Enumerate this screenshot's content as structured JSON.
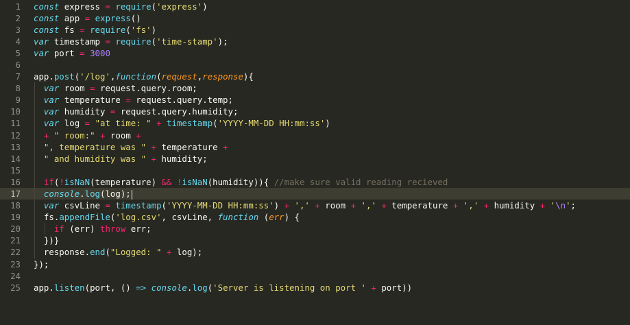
{
  "editor": {
    "colors": {
      "background": "#272822",
      "active_line": "#3e3d32",
      "keyword": "#66d9ef",
      "operator": "#f92672",
      "string": "#e6db74",
      "number": "#ae81ff",
      "parameter": "#fd971f",
      "comment": "#75715e",
      "text": "#f8f8f2",
      "gutter": "#90908a"
    },
    "active_line_number": "17",
    "lines": [
      {
        "n": "1",
        "tokens": [
          [
            "kw",
            "const"
          ],
          [
            "pl",
            " express "
          ],
          [
            "op",
            "="
          ],
          [
            "pl",
            " "
          ],
          [
            "fn",
            "require"
          ],
          [
            "pl",
            "("
          ],
          [
            "str",
            "'express'"
          ],
          [
            "pl",
            ")"
          ]
        ]
      },
      {
        "n": "2",
        "tokens": [
          [
            "kw",
            "const"
          ],
          [
            "pl",
            " app "
          ],
          [
            "op",
            "="
          ],
          [
            "pl",
            " "
          ],
          [
            "fn",
            "express"
          ],
          [
            "pl",
            "()"
          ]
        ]
      },
      {
        "n": "3",
        "tokens": [
          [
            "kw",
            "const"
          ],
          [
            "pl",
            " fs "
          ],
          [
            "op",
            "="
          ],
          [
            "pl",
            " "
          ],
          [
            "fn",
            "require"
          ],
          [
            "pl",
            "("
          ],
          [
            "str",
            "'fs'"
          ],
          [
            "pl",
            ")"
          ]
        ]
      },
      {
        "n": "4",
        "tokens": [
          [
            "kw",
            "var"
          ],
          [
            "pl",
            " timestamp "
          ],
          [
            "op",
            "="
          ],
          [
            "pl",
            " "
          ],
          [
            "fn",
            "require"
          ],
          [
            "pl",
            "("
          ],
          [
            "str",
            "'time-stamp'"
          ],
          [
            "pl",
            ");"
          ]
        ]
      },
      {
        "n": "5",
        "tokens": [
          [
            "kw",
            "var"
          ],
          [
            "pl",
            " port "
          ],
          [
            "op",
            "="
          ],
          [
            "pl",
            " "
          ],
          [
            "num",
            "3000"
          ]
        ]
      },
      {
        "n": "6",
        "tokens": []
      },
      {
        "n": "7",
        "tokens": [
          [
            "pl",
            "app."
          ],
          [
            "fn",
            "post"
          ],
          [
            "pl",
            "("
          ],
          [
            "str",
            "'/log'"
          ],
          [
            "pl",
            ","
          ],
          [
            "kw",
            "function"
          ],
          [
            "pl",
            "("
          ],
          [
            "param",
            "request"
          ],
          [
            "pl",
            ","
          ],
          [
            "param",
            "response"
          ],
          [
            "pl",
            "){"
          ]
        ]
      },
      {
        "n": "8",
        "tokens": [
          [
            "pl",
            "  "
          ],
          [
            "kw",
            "var"
          ],
          [
            "pl",
            " room "
          ],
          [
            "op",
            "="
          ],
          [
            "pl",
            " request.query.room;"
          ]
        ]
      },
      {
        "n": "9",
        "tokens": [
          [
            "pl",
            "  "
          ],
          [
            "kw",
            "var"
          ],
          [
            "pl",
            " temperature "
          ],
          [
            "op",
            "="
          ],
          [
            "pl",
            " request.query.temp;"
          ]
        ]
      },
      {
        "n": "10",
        "tokens": [
          [
            "pl",
            "  "
          ],
          [
            "kw",
            "var"
          ],
          [
            "pl",
            " humidity "
          ],
          [
            "op",
            "="
          ],
          [
            "pl",
            " request.query.humidity;"
          ]
        ]
      },
      {
        "n": "11",
        "tokens": [
          [
            "pl",
            "  "
          ],
          [
            "kw",
            "var"
          ],
          [
            "pl",
            " log "
          ],
          [
            "op",
            "="
          ],
          [
            "pl",
            " "
          ],
          [
            "str",
            "\"at time: \""
          ],
          [
            "pl",
            " "
          ],
          [
            "op",
            "+"
          ],
          [
            "pl",
            " "
          ],
          [
            "fn",
            "timestamp"
          ],
          [
            "pl",
            "("
          ],
          [
            "str",
            "'YYYY-MM-DD HH:mm:ss'"
          ],
          [
            "pl",
            ")"
          ]
        ]
      },
      {
        "n": "12",
        "tokens": [
          [
            "pl",
            "  "
          ],
          [
            "op",
            "+"
          ],
          [
            "pl",
            " "
          ],
          [
            "str",
            "\" room:\""
          ],
          [
            "pl",
            " "
          ],
          [
            "op",
            "+"
          ],
          [
            "pl",
            " room "
          ],
          [
            "op",
            "+"
          ]
        ]
      },
      {
        "n": "13",
        "tokens": [
          [
            "pl",
            "  "
          ],
          [
            "str",
            "\", temperature was \""
          ],
          [
            "pl",
            " "
          ],
          [
            "op",
            "+"
          ],
          [
            "pl",
            " temperature "
          ],
          [
            "op",
            "+"
          ]
        ]
      },
      {
        "n": "14",
        "tokens": [
          [
            "pl",
            "  "
          ],
          [
            "str",
            "\" and humidity was \""
          ],
          [
            "pl",
            " "
          ],
          [
            "op",
            "+"
          ],
          [
            "pl",
            " humidity;"
          ]
        ]
      },
      {
        "n": "15",
        "tokens": []
      },
      {
        "n": "16",
        "tokens": [
          [
            "pl",
            "  "
          ],
          [
            "op",
            "if"
          ],
          [
            "pl",
            "("
          ],
          [
            "op",
            "!"
          ],
          [
            "fn",
            "isNaN"
          ],
          [
            "pl",
            "(temperature) "
          ],
          [
            "op",
            "&&"
          ],
          [
            "pl",
            " "
          ],
          [
            "op",
            "!"
          ],
          [
            "fn",
            "isNaN"
          ],
          [
            "pl",
            "(humidity)){ "
          ],
          [
            "cmt",
            "//make sure valid reading recieved"
          ]
        ]
      },
      {
        "n": "17",
        "tokens": [
          [
            "pl",
            "  "
          ],
          [
            "kw",
            "console"
          ],
          [
            "pl",
            "."
          ],
          [
            "fn",
            "log"
          ],
          [
            "pl",
            "(log);"
          ]
        ]
      },
      {
        "n": "18",
        "tokens": [
          [
            "pl",
            "  "
          ],
          [
            "kw",
            "var"
          ],
          [
            "pl",
            " csvLine "
          ],
          [
            "op",
            "="
          ],
          [
            "pl",
            " "
          ],
          [
            "fn",
            "timestamp"
          ],
          [
            "pl",
            "("
          ],
          [
            "str",
            "'YYYY-MM-DD HH:mm:ss'"
          ],
          [
            "pl",
            ") "
          ],
          [
            "op",
            "+"
          ],
          [
            "pl",
            " "
          ],
          [
            "str",
            "','"
          ],
          [
            "pl",
            " "
          ],
          [
            "op",
            "+"
          ],
          [
            "pl",
            " room "
          ],
          [
            "op",
            "+"
          ],
          [
            "pl",
            " "
          ],
          [
            "str",
            "','"
          ],
          [
            "pl",
            " "
          ],
          [
            "op",
            "+"
          ],
          [
            "pl",
            " temperature "
          ],
          [
            "op",
            "+"
          ],
          [
            "pl",
            " "
          ],
          [
            "str",
            "','"
          ],
          [
            "pl",
            " "
          ],
          [
            "op",
            "+"
          ],
          [
            "pl",
            " humidity "
          ],
          [
            "op",
            "+"
          ],
          [
            "pl",
            " "
          ],
          [
            "str",
            "'"
          ],
          [
            "num",
            "\\n"
          ],
          [
            "str",
            "'"
          ],
          [
            "pl",
            ";"
          ]
        ]
      },
      {
        "n": "19",
        "tokens": [
          [
            "pl",
            "  fs."
          ],
          [
            "fn",
            "appendFile"
          ],
          [
            "pl",
            "("
          ],
          [
            "str",
            "'log.csv'"
          ],
          [
            "pl",
            ", csvLine, "
          ],
          [
            "kw",
            "function"
          ],
          [
            "pl",
            " ("
          ],
          [
            "param",
            "err"
          ],
          [
            "pl",
            ") {"
          ]
        ]
      },
      {
        "n": "20",
        "tokens": [
          [
            "pl",
            "    "
          ],
          [
            "op",
            "if"
          ],
          [
            "pl",
            " (err) "
          ],
          [
            "op",
            "throw"
          ],
          [
            "pl",
            " err;"
          ]
        ]
      },
      {
        "n": "21",
        "tokens": [
          [
            "pl",
            "  })}"
          ]
        ]
      },
      {
        "n": "22",
        "tokens": [
          [
            "pl",
            "  response."
          ],
          [
            "fn",
            "end"
          ],
          [
            "pl",
            "("
          ],
          [
            "str",
            "\"Logged: \""
          ],
          [
            "pl",
            " "
          ],
          [
            "op",
            "+"
          ],
          [
            "pl",
            " log);"
          ]
        ]
      },
      {
        "n": "23",
        "tokens": [
          [
            "pl",
            "});"
          ]
        ]
      },
      {
        "n": "24",
        "tokens": []
      },
      {
        "n": "25",
        "tokens": [
          [
            "pl",
            "app."
          ],
          [
            "fn",
            "listen"
          ],
          [
            "pl",
            "(port, () "
          ],
          [
            "kw",
            "=>"
          ],
          [
            "pl",
            " "
          ],
          [
            "kw",
            "console"
          ],
          [
            "pl",
            "."
          ],
          [
            "fn",
            "log"
          ],
          [
            "pl",
            "("
          ],
          [
            "str",
            "'Server is listening on port '"
          ],
          [
            "pl",
            " "
          ],
          [
            "op",
            "+"
          ],
          [
            "pl",
            " port))"
          ]
        ]
      }
    ]
  }
}
